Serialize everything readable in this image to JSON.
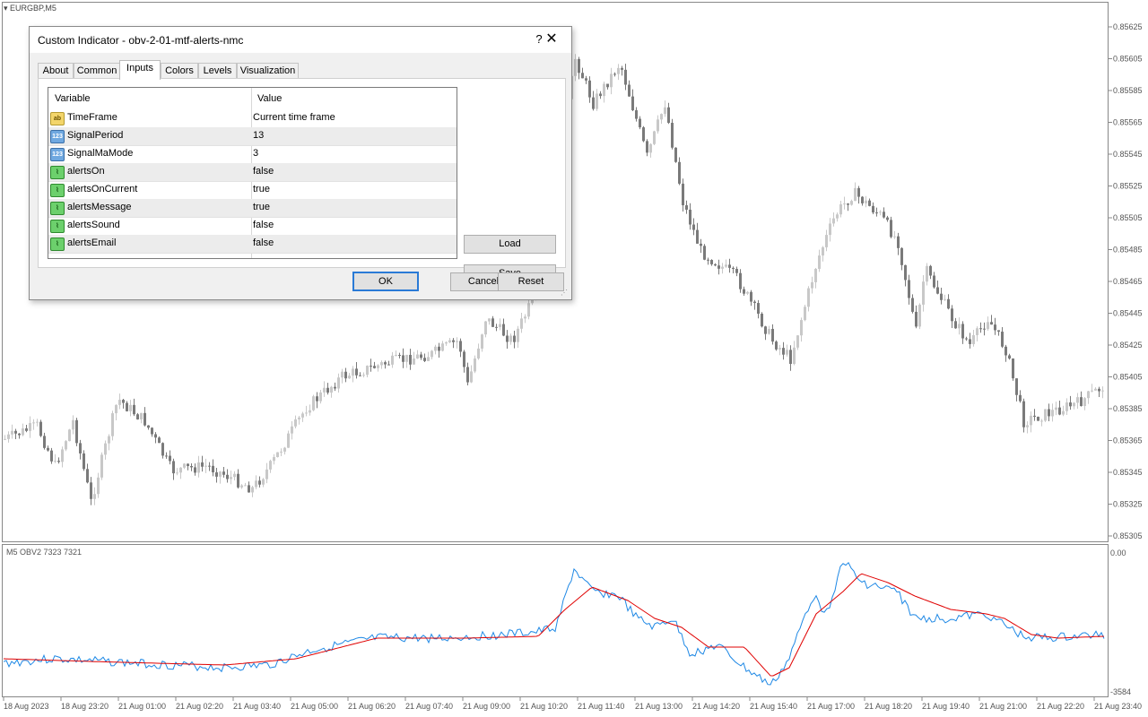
{
  "chart": {
    "symbol": "EURGBP,M5",
    "indicator_label": "M5 OBV2 7323 7321",
    "price_labels": [
      "0.85625",
      "0.85605",
      "0.85585",
      "0.85565",
      "0.85545",
      "0.85525",
      "0.85505",
      "0.85485",
      "0.85465",
      "0.85445",
      "0.85425",
      "0.85405",
      "0.85385",
      "0.85365",
      "0.85345",
      "0.85325",
      "0.85305"
    ],
    "indicator_top_label": "0.00",
    "indicator_bottom_label": "-3584",
    "time_labels": [
      "18 Aug 2023",
      "18 Aug 23:20",
      "21 Aug 01:00",
      "21 Aug 02:20",
      "21 Aug 03:40",
      "21 Aug 05:00",
      "21 Aug 06:20",
      "21 Aug 07:40",
      "21 Aug 09:00",
      "21 Aug 10:20",
      "21 Aug 11:40",
      "21 Aug 13:00",
      "21 Aug 14:20",
      "21 Aug 15:40",
      "21 Aug 17:00",
      "21 Aug 18:20",
      "21 Aug 19:40",
      "21 Aug 21:00",
      "21 Aug 22:20",
      "21 Aug 23:40"
    ],
    "colors": {
      "bull": "#c8c8c8",
      "bear": "#7a7a7a",
      "obv": "#1e88e5",
      "signal": "#e00000"
    }
  },
  "dialog": {
    "title": "Custom Indicator - obv-2-01-mtf-alerts-nmc",
    "help_label": "?",
    "close_label": "✕",
    "tabs": [
      "About",
      "Common",
      "Inputs",
      "Colors",
      "Levels",
      "Visualization"
    ],
    "active_tab": "Inputs",
    "columns": {
      "variable": "Variable",
      "value": "Value"
    },
    "rows": [
      {
        "icon": "string-icon",
        "icon_text": "ab",
        "name": "TimeFrame",
        "value": "Current time frame"
      },
      {
        "icon": "number-icon",
        "icon_text": "123",
        "name": "SignalPeriod",
        "value": "13"
      },
      {
        "icon": "number-icon",
        "icon_text": "123",
        "name": "SignalMaMode",
        "value": "3"
      },
      {
        "icon": "bool-icon",
        "icon_text": "",
        "name": "alertsOn",
        "value": "false"
      },
      {
        "icon": "bool-icon",
        "icon_text": "",
        "name": "alertsOnCurrent",
        "value": "true"
      },
      {
        "icon": "bool-icon",
        "icon_text": "",
        "name": "alertsMessage",
        "value": "true"
      },
      {
        "icon": "bool-icon",
        "icon_text": "",
        "name": "alertsSound",
        "value": "false"
      },
      {
        "icon": "bool-icon",
        "icon_text": "",
        "name": "alertsEmail",
        "value": "false"
      }
    ],
    "buttons": {
      "load": "Load",
      "save": "Save",
      "ok": "OK",
      "cancel": "Cancel",
      "reset": "Reset"
    }
  }
}
